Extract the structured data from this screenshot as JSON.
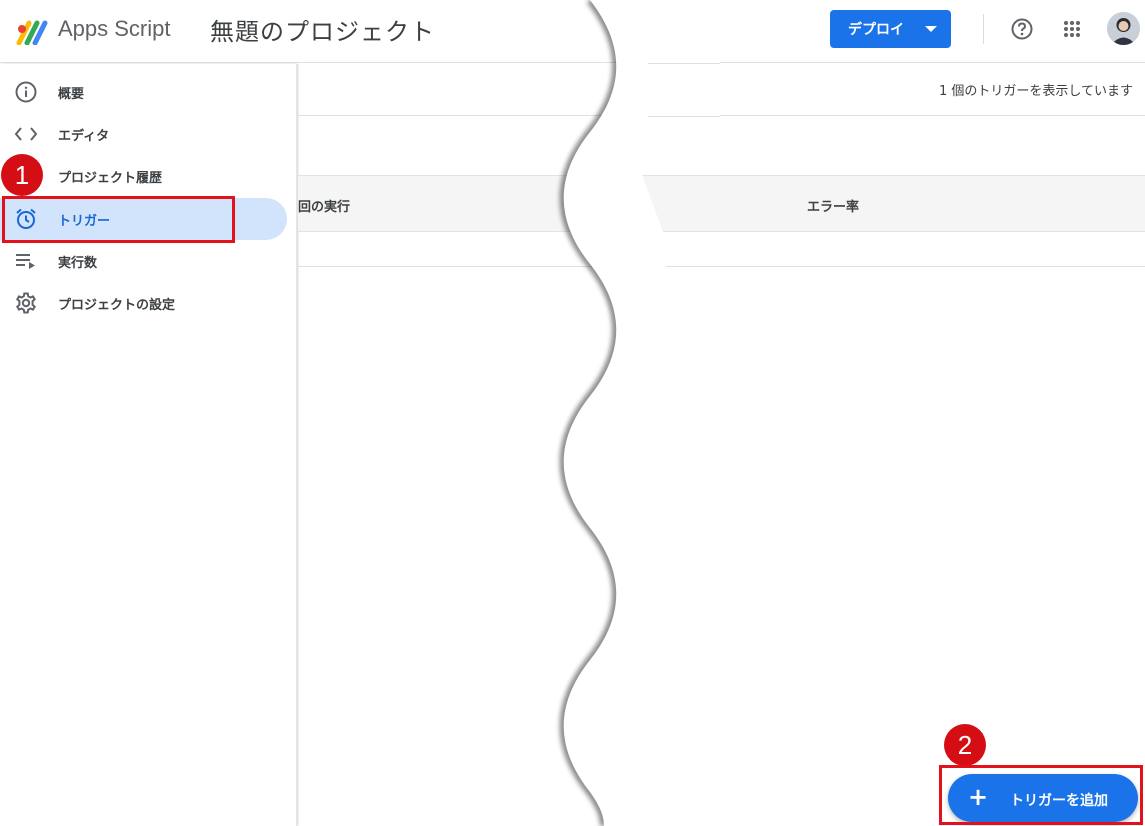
{
  "header": {
    "app_name": "Apps Script",
    "project_title": "無題のプロジェクト",
    "deploy_label": "デプロイ"
  },
  "sidebar": {
    "items": [
      {
        "label": "概要",
        "icon": "info-icon"
      },
      {
        "label": "エディタ",
        "icon": "code-icon"
      },
      {
        "label": "プロジェクト履歴",
        "icon": "history-icon"
      },
      {
        "label": "トリガー",
        "icon": "alarm-icon",
        "active": true
      },
      {
        "label": "実行数",
        "icon": "executions-icon"
      },
      {
        "label": "プロジェクトの設定",
        "icon": "gear-icon"
      }
    ]
  },
  "main": {
    "trigger_count_text": "1 個のトリガーを表示しています",
    "columns": {
      "last_run": "回の実行",
      "error_rate": "エラー率"
    },
    "add_trigger_label": "トリガーを追加"
  },
  "callouts": [
    "1",
    "2"
  ],
  "colors": {
    "accent": "#1a73e8",
    "active_bg": "#d2e3fc",
    "callout": "#e1121b"
  }
}
